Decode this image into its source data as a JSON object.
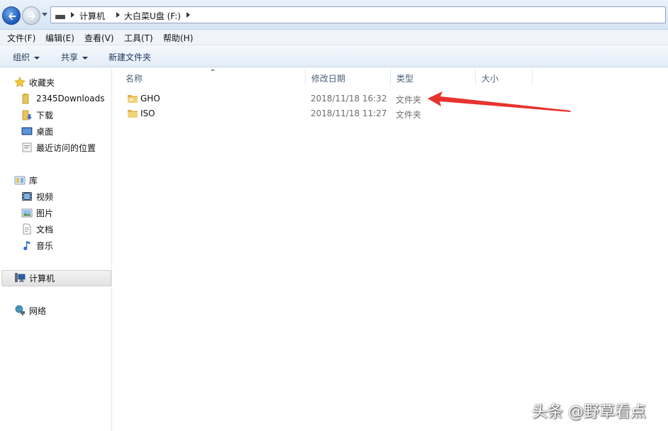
{
  "address_bar": {
    "breadcrumbs": [
      "计算机",
      "大白菜U盘 (F:)"
    ]
  },
  "menu": [
    "文件(F)",
    "编辑(E)",
    "查看(V)",
    "工具(T)",
    "帮助(H)"
  ],
  "commands": {
    "organize": "组织",
    "share": "共享",
    "new_folder": "新建文件夹"
  },
  "nav": {
    "favorites": "收藏夹",
    "fav_items": [
      "2345Downloads",
      "下载",
      "桌面",
      "最近访问的位置"
    ],
    "libraries": "库",
    "lib_items": [
      "视频",
      "图片",
      "文档",
      "音乐"
    ],
    "computer": "计算机",
    "network": "网络"
  },
  "columns": [
    "名称",
    "修改日期",
    "类型",
    "大小"
  ],
  "files": [
    {
      "name": "GHO",
      "date": "2018/11/18 16:32",
      "type": "文件夹"
    },
    {
      "name": "ISO",
      "date": "2018/11/18 11:27",
      "type": "文件夹"
    }
  ],
  "watermark": "头条 @野草看点",
  "colors": {
    "accent_arrow": "#e8322e",
    "header_text": "#4c607a",
    "folder": "#e8c25a"
  },
  "icons": [
    "back-arrow-icon",
    "forward-arrow-icon",
    "drive-icon",
    "star-icon",
    "folder-icon",
    "download-icon",
    "desktop-icon",
    "recent-places-icon",
    "library-icon",
    "video-icon",
    "picture-icon",
    "document-icon",
    "music-icon",
    "computer-icon",
    "network-icon"
  ]
}
